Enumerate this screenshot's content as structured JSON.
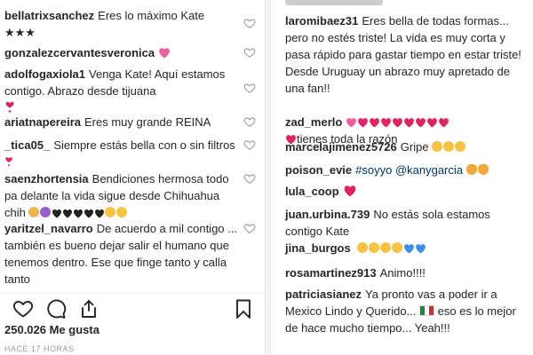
{
  "left_comments": [
    {
      "user": "bellatrixsanchez",
      "text": "Eres lo máximo Kate",
      "extra": "★★★"
    },
    {
      "user": "gonzalezcervantesveronica",
      "text": ""
    },
    {
      "user": "adolfogaxiola1",
      "text": "Venga Kate! Aquí estamos contigo. Abrazo desde tijuana"
    },
    {
      "user": "ariatnapereira",
      "text": "Eres muy grande REINA"
    },
    {
      "user": "_tica05_",
      "text": "Siempre estás bella con o sin filtros"
    },
    {
      "user": "saenzhortensia",
      "text": "Bendiciones hermosa todo pa delante la vida sigue desde Chihuahua chih"
    },
    {
      "user": "yaritzel_navarro",
      "text": "De acuerdo a mil contigo ... también es bueno dejar salir el humano que tenemos dentro. Ese que finge tanto y calla tanto"
    }
  ],
  "right_comments": [
    {
      "user": "laromibaez31",
      "text": "Eres bella de todas formas... pero no estés triste! La vida es muy corta y pasa rápido para gastar tiempo en estar triste! Desde Uruguay un abrazo muy apretado de una fan!!"
    },
    {
      "user": "zad_merlo",
      "text": "tienes toda la razón"
    },
    {
      "user": "marcelajimenez5726",
      "text": "Gripe"
    },
    {
      "user": "poison_evie",
      "text": "#soyyo @kanygarcia"
    },
    {
      "user": "lula_coop",
      "text": ""
    },
    {
      "user": "juan.urbina.739",
      "text": "No estás sola estamos contigo Kate"
    },
    {
      "user": "jina_burgos",
      "text": ""
    },
    {
      "user": "rosamartinez913",
      "text": "Animo!!!!"
    },
    {
      "user": "patriciasianez",
      "text": "Ya pronto vas a poder ir a Mexico Lindo y Querido...",
      "text2": "eso es lo mejor de hace mucho tiempo... Yeah!!!"
    }
  ],
  "footer": {
    "likes": "250.026 Me gusta",
    "time": "HACE 17 HORAS"
  },
  "icons": {
    "like": "heart-outline-icon",
    "comment": "comment-bubble-icon",
    "share": "share-arrow-icon",
    "save": "bookmark-icon"
  },
  "colors": {
    "heart_red": "#e0245e",
    "hashtag": "#003569",
    "muted": "#999999"
  }
}
